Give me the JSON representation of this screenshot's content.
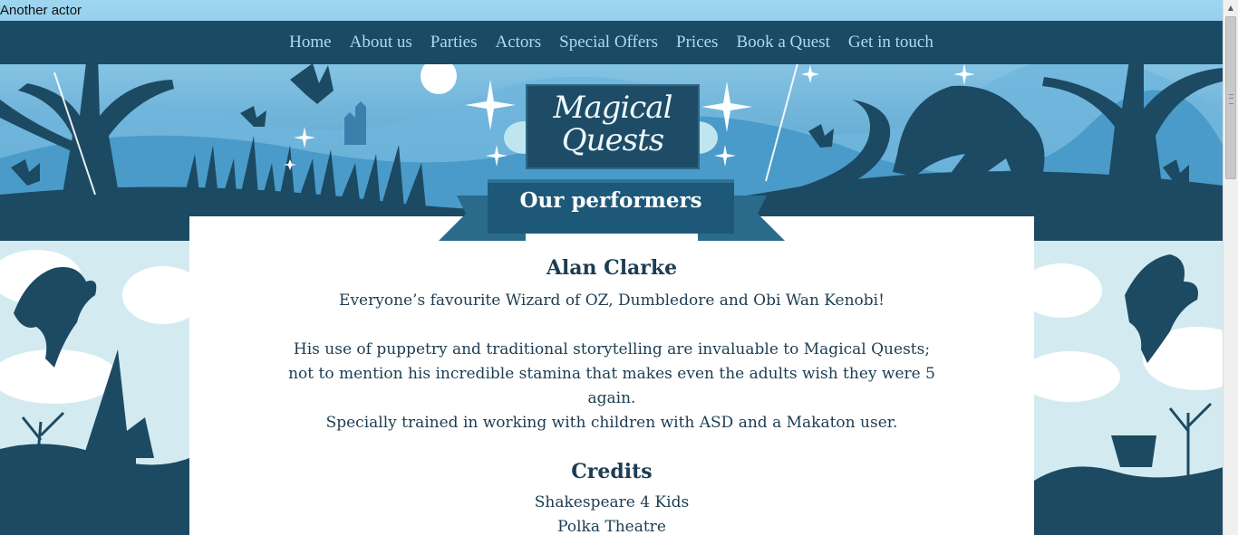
{
  "caption": "Another actor",
  "nav": {
    "items": [
      "Home",
      "About us",
      "Parties",
      "Actors",
      "Special Offers",
      "Prices",
      "Book a Quest",
      "Get in touch"
    ]
  },
  "logo": {
    "line1": "Magical",
    "line2": "Quests"
  },
  "page_title": "Our performers",
  "actor": {
    "name": "Alan Clarke",
    "tagline": "Everyone’s favourite Wizard of OZ, Dumbledore and Obi Wan Kenobi!",
    "bio": "His use of puppetry and traditional storytelling are invaluable to Magical Quests; not to mention his incredible stamina that makes even the adults wish they were 5 again.",
    "training": "Specially trained in working with children with ASD and a Makaton user."
  },
  "credits": {
    "title": "Credits",
    "items": [
      "Shakespeare 4 Kids",
      "Polka Theatre"
    ]
  },
  "colors": {
    "nav_bg": "#1a4b64",
    "nav_link": "#a9dbf2",
    "sky_light": "#8ccbe9",
    "sky_mid": "#4a9bc9",
    "silhouette": "#1c4a63",
    "content_text": "#1c3d52",
    "side_bg": "#d3ebf0"
  }
}
